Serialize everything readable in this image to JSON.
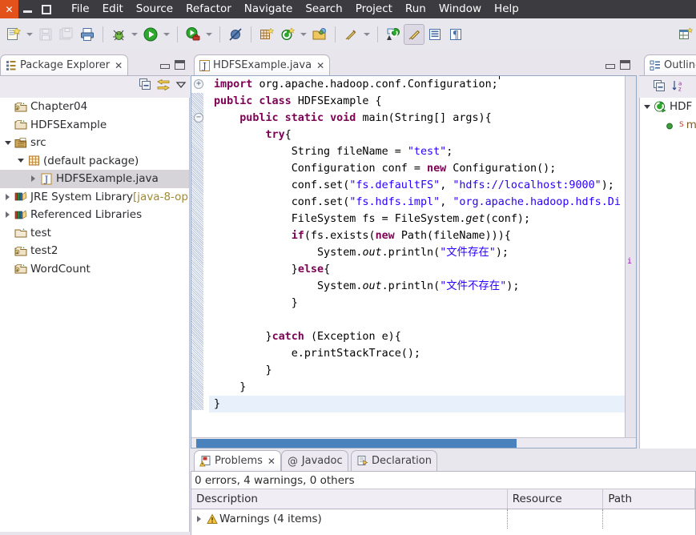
{
  "window": {
    "controls": {
      "close": "✕",
      "minimize": "minimize",
      "maximize": "maximize"
    }
  },
  "menubar": {
    "items": [
      "File",
      "Edit",
      "Source",
      "Refactor",
      "Navigate",
      "Search",
      "Project",
      "Run",
      "Window",
      "Help"
    ]
  },
  "toolbar": {
    "items": [
      {
        "name": "new-wizard-icon",
        "arrow": true
      },
      {
        "name": "save-icon",
        "arrow": false
      },
      {
        "name": "save-all-icon",
        "arrow": false
      },
      {
        "name": "print-icon",
        "arrow": false
      },
      {
        "name": "debug-icon",
        "arrow": true
      },
      {
        "name": "run-icon",
        "arrow": true
      },
      {
        "name": "run-external-tools-icon",
        "arrow": true
      },
      {
        "name": "skip-all-breakpoints-icon",
        "arrow": false
      },
      {
        "name": "new-java-package-icon",
        "arrow": false
      },
      {
        "name": "new-java-class-icon",
        "arrow": true
      },
      {
        "name": "open-type-icon",
        "arrow": false
      },
      {
        "name": "search-icon",
        "arrow": true
      },
      {
        "name": "next-annotation-icon",
        "arrow": false
      },
      {
        "name": "toggle-mark-occurrences-icon",
        "arrow": false,
        "pressed": true
      },
      {
        "name": "toggle-block-selection-icon",
        "arrow": false
      },
      {
        "name": "show-whitespace-icon",
        "arrow": false
      },
      {
        "name": "open-perspective-icon",
        "arrow": false
      }
    ]
  },
  "package_explorer": {
    "title": "Package Explorer",
    "close_glyph": "✕",
    "tools": [
      "collapse-all-icon",
      "link-with-editor-icon",
      "view-menu-icon"
    ],
    "tree": [
      {
        "label": "Chapter04",
        "icon": "java-project-icon",
        "indent": 0,
        "twisty": "none",
        "selected": false
      },
      {
        "label": "HDFSExample",
        "icon": "java-project-open-icon",
        "indent": 0,
        "twisty": "none",
        "selected": false
      },
      {
        "label": "src",
        "icon": "source-folder-icon",
        "indent": 0,
        "twisty": "down",
        "selected": false
      },
      {
        "label": "(default package)",
        "icon": "package-icon",
        "indent": 1,
        "twisty": "down",
        "selected": false
      },
      {
        "label": "HDFSExample.java",
        "icon": "java-file-icon",
        "indent": 2,
        "twisty": "right",
        "selected": true
      },
      {
        "label": "JRE System Library ",
        "suffix": "[java-8-op",
        "icon": "library-icon",
        "indent": 0,
        "twisty": "right",
        "selected": false
      },
      {
        "label": "Referenced Libraries",
        "icon": "library-icon",
        "indent": 0,
        "twisty": "right",
        "selected": false
      },
      {
        "label": "test",
        "icon": "project-open-icon",
        "indent": 0,
        "twisty": "none",
        "selected": false
      },
      {
        "label": "test2",
        "icon": "java-project-icon",
        "indent": 0,
        "twisty": "none",
        "selected": false
      },
      {
        "label": "WordCount",
        "icon": "java-project-icon",
        "indent": 0,
        "twisty": "none",
        "selected": false
      }
    ]
  },
  "editor": {
    "tab_label": "HDFSExample.java",
    "tab_icon": "java-file-icon",
    "close_glyph": "✕",
    "overview_marker": "i",
    "lines": [
      {
        "tokens": [
          {
            "t": "import ",
            "c": "kw"
          },
          {
            "t": "org.apache.hadoop.conf.Configuration;",
            "c": ""
          }
        ],
        "fold": "plus",
        "current": false
      },
      {
        "tokens": [
          {
            "t": "public class ",
            "c": "kw"
          },
          {
            "t": "HDFSExample {",
            "c": ""
          }
        ],
        "fold": "",
        "current": false
      },
      {
        "tokens": [
          {
            "t": "    ",
            "c": ""
          },
          {
            "t": "public static void ",
            "c": "kw"
          },
          {
            "t": "main(String[] args){",
            "c": ""
          }
        ],
        "fold": "minus",
        "current": false
      },
      {
        "tokens": [
          {
            "t": "        ",
            "c": ""
          },
          {
            "t": "try",
            "c": "kw"
          },
          {
            "t": "{",
            "c": ""
          }
        ],
        "fold": "",
        "current": false
      },
      {
        "tokens": [
          {
            "t": "            String fileName = ",
            "c": ""
          },
          {
            "t": "\"test\"",
            "c": "str"
          },
          {
            "t": ";",
            "c": ""
          }
        ],
        "fold": "",
        "current": false
      },
      {
        "tokens": [
          {
            "t": "            Configuration conf = ",
            "c": ""
          },
          {
            "t": "new ",
            "c": "kw"
          },
          {
            "t": "Configuration();",
            "c": ""
          }
        ],
        "fold": "",
        "current": false
      },
      {
        "tokens": [
          {
            "t": "            conf.set(",
            "c": ""
          },
          {
            "t": "\"fs.defaultFS\"",
            "c": "str"
          },
          {
            "t": ", ",
            "c": ""
          },
          {
            "t": "\"hdfs://localhost:9000\"",
            "c": "str"
          },
          {
            "t": ");",
            "c": ""
          }
        ],
        "fold": "",
        "current": false
      },
      {
        "tokens": [
          {
            "t": "            conf.set(",
            "c": ""
          },
          {
            "t": "\"fs.hdfs.impl\"",
            "c": "str"
          },
          {
            "t": ", ",
            "c": ""
          },
          {
            "t": "\"org.apache.hadoop.hdfs.Di",
            "c": "str"
          }
        ],
        "fold": "",
        "current": false
      },
      {
        "tokens": [
          {
            "t": "            FileSystem fs = FileSystem.",
            "c": ""
          },
          {
            "t": "get",
            "c": "itl"
          },
          {
            "t": "(conf);",
            "c": ""
          }
        ],
        "fold": "",
        "current": false
      },
      {
        "tokens": [
          {
            "t": "            ",
            "c": ""
          },
          {
            "t": "if",
            "c": "kw"
          },
          {
            "t": "(fs.exists(",
            "c": ""
          },
          {
            "t": "new ",
            "c": "kw"
          },
          {
            "t": "Path(fileName))){",
            "c": ""
          }
        ],
        "fold": "",
        "current": false
      },
      {
        "tokens": [
          {
            "t": "                System.",
            "c": ""
          },
          {
            "t": "out",
            "c": "itl"
          },
          {
            "t": ".println(",
            "c": ""
          },
          {
            "t": "\"文件存在\"",
            "c": "str"
          },
          {
            "t": ");",
            "c": ""
          }
        ],
        "fold": "",
        "current": false
      },
      {
        "tokens": [
          {
            "t": "            }",
            "c": ""
          },
          {
            "t": "else",
            "c": "kw"
          },
          {
            "t": "{",
            "c": ""
          }
        ],
        "fold": "",
        "current": false
      },
      {
        "tokens": [
          {
            "t": "                System.",
            "c": ""
          },
          {
            "t": "out",
            "c": "itl"
          },
          {
            "t": ".println(",
            "c": ""
          },
          {
            "t": "\"文件不存在\"",
            "c": "str"
          },
          {
            "t": ");",
            "c": ""
          }
        ],
        "fold": "",
        "current": false
      },
      {
        "tokens": [
          {
            "t": "            }",
            "c": ""
          }
        ],
        "fold": "",
        "current": false
      },
      {
        "tokens": [
          {
            "t": "",
            "c": ""
          }
        ],
        "fold": "",
        "current": false
      },
      {
        "tokens": [
          {
            "t": "        }",
            "c": ""
          },
          {
            "t": "catch ",
            "c": "kw"
          },
          {
            "t": "(Exception e){",
            "c": ""
          }
        ],
        "fold": "",
        "current": false
      },
      {
        "tokens": [
          {
            "t": "            e.printStackTrace();",
            "c": ""
          }
        ],
        "fold": "",
        "current": false
      },
      {
        "tokens": [
          {
            "t": "        }",
            "c": ""
          }
        ],
        "fold": "",
        "current": false
      },
      {
        "tokens": [
          {
            "t": "    }",
            "c": ""
          }
        ],
        "fold": "",
        "current": false
      },
      {
        "tokens": [
          {
            "t": "}",
            "c": ""
          }
        ],
        "fold": "",
        "current": true
      }
    ]
  },
  "outline": {
    "title": "Outline",
    "tools": [
      "collapse-all-icon",
      "sort-icon"
    ],
    "tree": [
      {
        "label": "HDF",
        "icon": "class-icon",
        "indent": 0,
        "twisty": "down"
      },
      {
        "label": "ma",
        "icon": "method-public-static-icon",
        "badge": "S",
        "indent": 1,
        "twisty": "none"
      }
    ]
  },
  "bottom": {
    "tabs": [
      {
        "label": "Problems",
        "icon": "problems-icon",
        "active": true,
        "close_glyph": "✕"
      },
      {
        "label": "Javadoc",
        "icon": "javadoc-icon",
        "active": false
      },
      {
        "label": "Declaration",
        "icon": "declaration-icon",
        "active": false
      }
    ],
    "summary": "0 errors, 4 warnings, 0 others",
    "columns": [
      "Description",
      "Resource",
      "Path"
    ],
    "rows": [
      {
        "description": "Warnings (4 items)",
        "icon": "warning-icon",
        "twisty": "right",
        "resource": "",
        "path": ""
      }
    ]
  },
  "colors": {
    "titlebar": "#3b3b40",
    "close_button": "#e4521b",
    "toolbar_bg": "#e9e7ee",
    "keyword": "#7f0055",
    "string": "#2a00ff",
    "selection": "#d6d4d9",
    "current_line": "#e8f0fb",
    "scrollbar_thumb": "#4a82bd"
  }
}
